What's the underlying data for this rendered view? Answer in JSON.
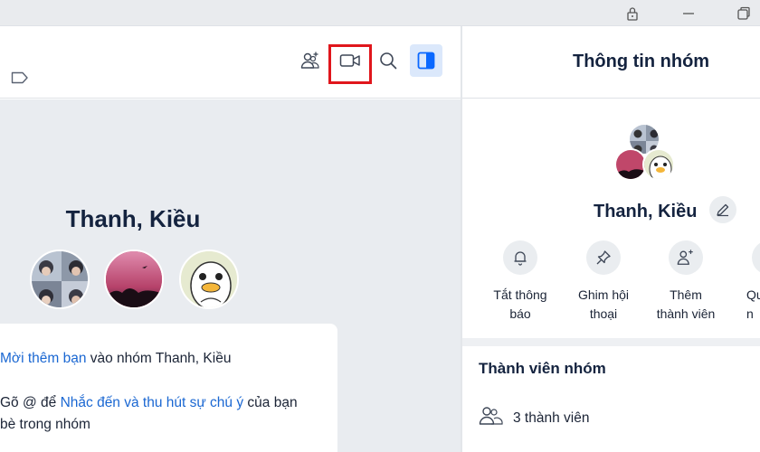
{
  "chat": {
    "group_name": "Thanh, Kiều",
    "welcome_card": {
      "line1_link": "Mời thêm bạn",
      "line1_text": " vào nhóm Thanh, Kiều",
      "line2_prefix": "Gõ @ để ",
      "line2_link": "Nhắc đến và thu hút sự chú ý",
      "line2_suffix": " của bạn",
      "line3_text": "bè trong nhóm"
    }
  },
  "info_panel": {
    "title": "Thông tin nhóm",
    "group_name": "Thanh, Kiều",
    "actions": [
      {
        "label_line1": "Tắt thông",
        "label_line2": "báo",
        "icon": "bell-icon"
      },
      {
        "label_line1": "Ghim hội",
        "label_line2": "thoại",
        "icon": "pin-icon"
      },
      {
        "label_line1": "Thêm",
        "label_line2": "thành viên",
        "icon": "add-member-icon"
      },
      {
        "label_line1": "Qu",
        "label_line2": "n",
        "icon": "manage-icon"
      }
    ],
    "members_section_title": "Thành viên nhóm",
    "members_count": "3 thành viên"
  },
  "colors": {
    "accent": "#1a67d2",
    "highlight_border": "#e0161c",
    "panel_toggle_bg": "#dbe8fb",
    "chat_background": "#e9ecf0"
  }
}
